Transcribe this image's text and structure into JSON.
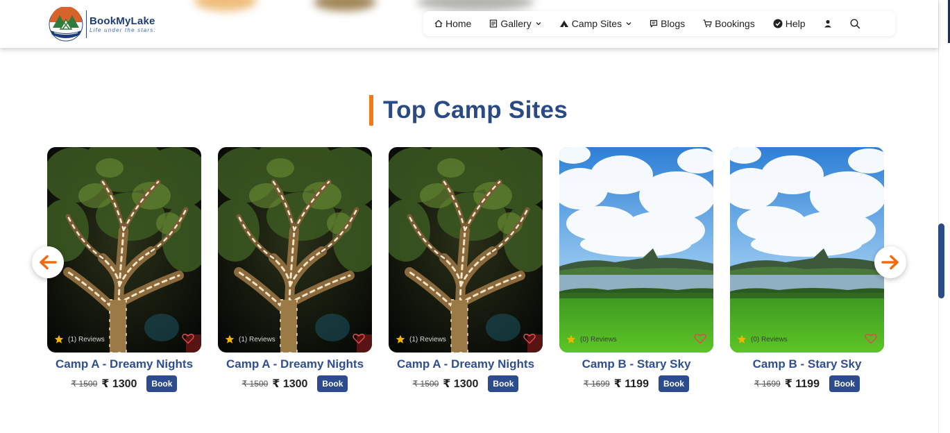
{
  "brand": {
    "name": "BookMyLake",
    "tagline": "Life under the stars."
  },
  "nav": {
    "items": [
      {
        "label": "Home",
        "icon": "home-icon"
      },
      {
        "label": "Gallery",
        "icon": "gallery-icon",
        "dropdown": true
      },
      {
        "label": "Camp Sites",
        "icon": "tent-icon",
        "dropdown": true
      },
      {
        "label": "Blogs",
        "icon": "blog-icon"
      },
      {
        "label": "Bookings",
        "icon": "cart-icon"
      },
      {
        "label": "Help",
        "icon": "help-icon"
      }
    ],
    "account_icon": "user-icon",
    "search_icon": "search-icon"
  },
  "section": {
    "title": "Top Camp Sites"
  },
  "cards": [
    {
      "name": "Camp A - Dreamy Nights",
      "reviews": "(1) Reviews",
      "old_price": "₹ 1500",
      "price": "₹ 1300",
      "book_label": "Book",
      "image": "night-tree"
    },
    {
      "name": "Camp A - Dreamy Nights",
      "reviews": "(1) Reviews",
      "old_price": "₹ 1500",
      "price": "₹ 1300",
      "book_label": "Book",
      "image": "night-tree"
    },
    {
      "name": "Camp A - Dreamy Nights",
      "reviews": "(1) Reviews",
      "old_price": "₹ 1500",
      "price": "₹ 1300",
      "book_label": "Book",
      "image": "night-tree"
    },
    {
      "name": "Camp B - Stary Sky",
      "reviews": "(0) Reviews",
      "old_price": "₹ 1699",
      "price": "₹ 1199",
      "book_label": "Book",
      "image": "lake-landscape"
    },
    {
      "name": "Camp B - Stary Sky",
      "reviews": "(0) Reviews",
      "old_price": "₹ 1699",
      "price": "₹ 1199",
      "book_label": "Book",
      "image": "lake-landscape"
    }
  ],
  "colors": {
    "brand_blue": "#2a4a86",
    "accent_orange": "#f07a1a",
    "button_blue": "#2d4c8e"
  }
}
